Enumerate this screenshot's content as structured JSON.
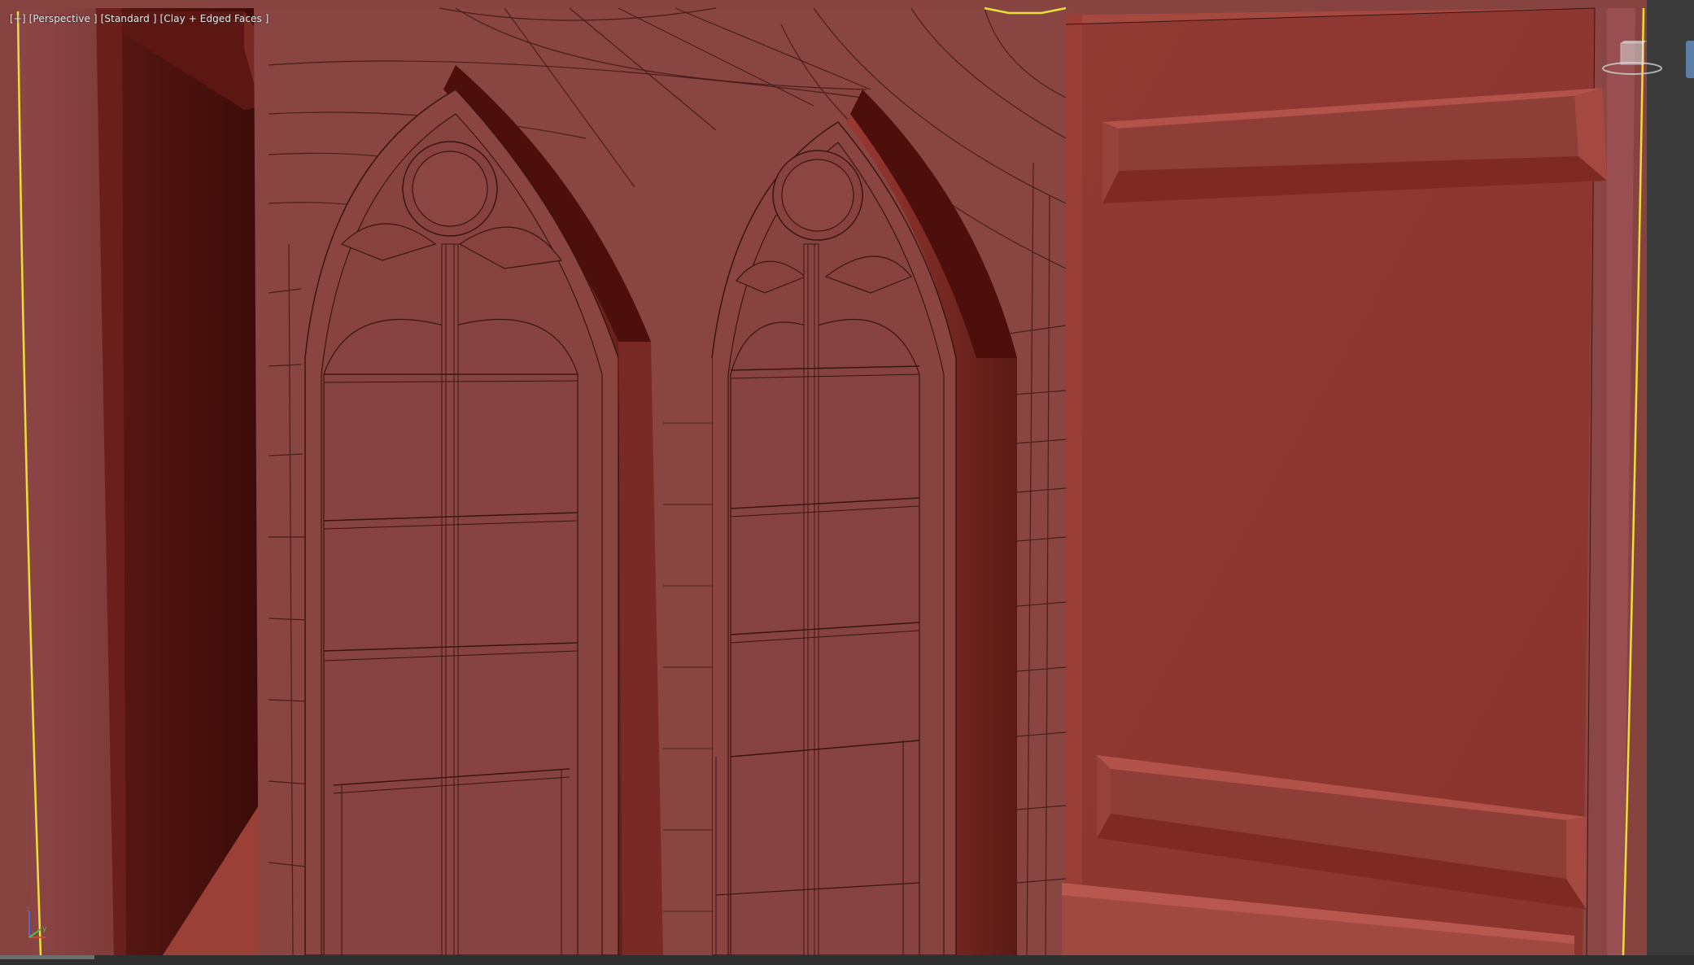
{
  "viewport": {
    "label_parts": [
      "[+]",
      "[Perspective ]",
      "[Standard ]",
      "[Clay + Edged Faces ]"
    ],
    "view_mode": "Perspective",
    "shading_preset": "Standard",
    "display_mode": "Clay + Edged Faces"
  },
  "icons": {
    "view_cube": "view-cube-icon",
    "axis_gizmo": "axis-tripod-icon"
  },
  "colors": {
    "clay": "#8c3b36",
    "clay_light": "#a5493f",
    "clay_dark": "#4a1410",
    "selection_border": "#e8e03a",
    "viewport_bg": "#444444",
    "wire": "#3a1512"
  }
}
